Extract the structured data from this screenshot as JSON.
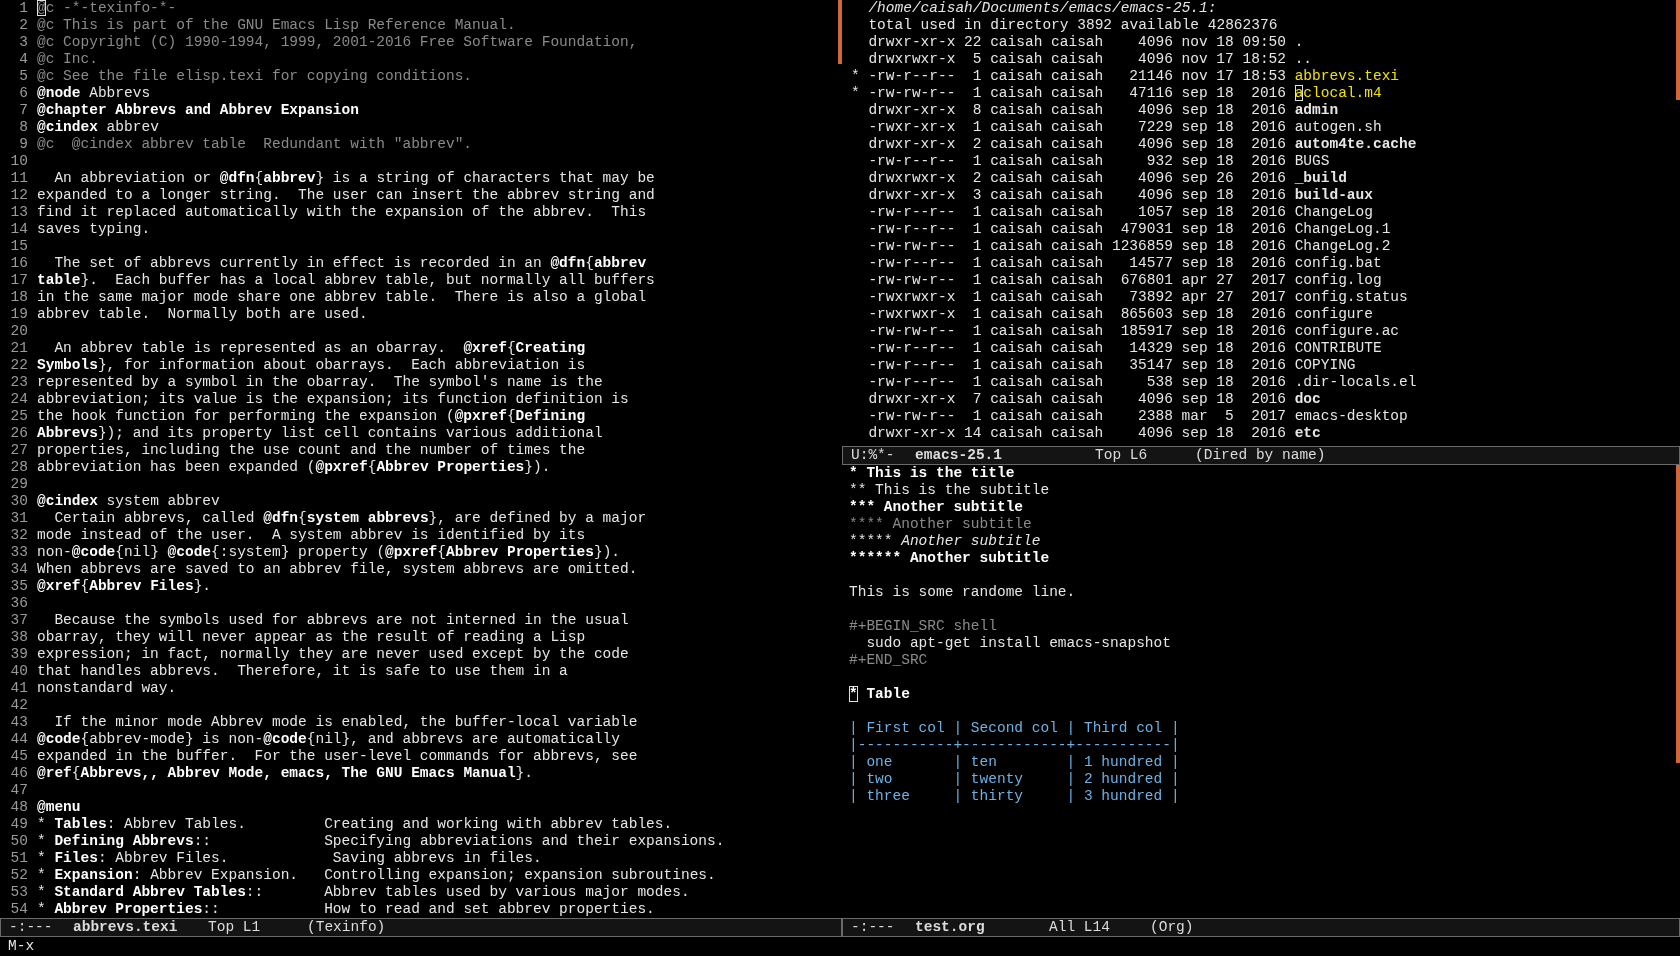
{
  "texinfo_buffer": {
    "lines": [
      {
        "n": "1",
        "kind": "comment",
        "cursor": true,
        "text": "@c -*-texinfo-*-"
      },
      {
        "n": "2",
        "kind": "comment",
        "text": "@c This is part of the GNU Emacs Lisp Reference Manual."
      },
      {
        "n": "3",
        "kind": "comment",
        "text": "@c Copyright (C) 1990-1994, 1999, 2001-2016 Free Software Foundation,"
      },
      {
        "n": "4",
        "kind": "comment",
        "text": "@c Inc."
      },
      {
        "n": "5",
        "kind": "comment",
        "text": "@c See the file elisp.texi for copying conditions."
      },
      {
        "n": "6",
        "kind": "text",
        "segs": [
          {
            "b": "@node"
          },
          " Abbrevs"
        ]
      },
      {
        "n": "7",
        "kind": "text",
        "segs": [
          {
            "b": "@chapter Abbrevs and Abbrev Expansion"
          }
        ]
      },
      {
        "n": "8",
        "kind": "text",
        "segs": [
          {
            "b": "@cindex"
          },
          " abbrev"
        ]
      },
      {
        "n": "9",
        "kind": "comment",
        "text": "@c  @cindex abbrev table  Redundant with \"abbrev\"."
      },
      {
        "n": "10",
        "kind": "blank"
      },
      {
        "n": "11",
        "kind": "text",
        "segs": [
          "  An abbreviation or ",
          {
            "b": "@dfn"
          },
          "{",
          {
            "b": "abbrev"
          },
          "} is a string of characters that may be"
        ]
      },
      {
        "n": "12",
        "kind": "text",
        "text": "expanded to a longer string.  The user can insert the abbrev string and"
      },
      {
        "n": "13",
        "kind": "text",
        "text": "find it replaced automatically with the expansion of the abbrev.  This"
      },
      {
        "n": "14",
        "kind": "text",
        "text": "saves typing."
      },
      {
        "n": "15",
        "kind": "blank"
      },
      {
        "n": "16",
        "kind": "text",
        "segs": [
          "  The set of abbrevs currently in effect is recorded in an ",
          {
            "b": "@dfn"
          },
          "{",
          {
            "b": "abbrev"
          }
        ]
      },
      {
        "n": "17",
        "kind": "text",
        "segs": [
          {
            "b": "table"
          },
          "}.  Each buffer has a local abbrev table, but normally all buffers"
        ]
      },
      {
        "n": "18",
        "kind": "text",
        "text": "in the same major mode share one abbrev table.  There is also a global"
      },
      {
        "n": "19",
        "kind": "text",
        "text": "abbrev table.  Normally both are used."
      },
      {
        "n": "20",
        "kind": "blank"
      },
      {
        "n": "21",
        "kind": "text",
        "segs": [
          "  An abbrev table is represented as an obarray.  ",
          {
            "b": "@xref"
          },
          "{",
          {
            "b": "Creating"
          }
        ]
      },
      {
        "n": "22",
        "kind": "text",
        "segs": [
          {
            "b": "Symbols"
          },
          "}, for information about obarrays.  Each abbreviation is"
        ]
      },
      {
        "n": "23",
        "kind": "text",
        "text": "represented by a symbol in the obarray.  The symbol's name is the"
      },
      {
        "n": "24",
        "kind": "text",
        "text": "abbreviation; its value is the expansion; its function definition is"
      },
      {
        "n": "25",
        "kind": "text",
        "segs": [
          "the hook function for performing the expansion (",
          {
            "b": "@pxref"
          },
          "{",
          {
            "b": "Defining"
          }
        ]
      },
      {
        "n": "26",
        "kind": "text",
        "segs": [
          {
            "b": "Abbrevs"
          },
          "}); and its property list cell contains various additional"
        ]
      },
      {
        "n": "27",
        "kind": "text",
        "text": "properties, including the use count and the number of times the"
      },
      {
        "n": "28",
        "kind": "text",
        "segs": [
          "abbreviation has been expanded (",
          {
            "b": "@pxref"
          },
          "{",
          {
            "b": "Abbrev Properties"
          },
          "})."
        ]
      },
      {
        "n": "29",
        "kind": "blank"
      },
      {
        "n": "30",
        "kind": "text",
        "segs": [
          {
            "b": "@cindex"
          },
          " system abbrev"
        ]
      },
      {
        "n": "31",
        "kind": "text",
        "segs": [
          "  Certain abbrevs, called ",
          {
            "b": "@dfn"
          },
          "{",
          {
            "b": "system abbrevs"
          },
          "}, are defined by a major"
        ]
      },
      {
        "n": "32",
        "kind": "text",
        "text": "mode instead of the user.  A system abbrev is identified by its"
      },
      {
        "n": "33",
        "kind": "text",
        "segs": [
          "non-",
          {
            "b": "@code"
          },
          "{nil} ",
          {
            "b": "@code"
          },
          "{:system} property (",
          {
            "b": "@pxref"
          },
          "{",
          {
            "b": "Abbrev Properties"
          },
          "})."
        ]
      },
      {
        "n": "34",
        "kind": "text",
        "text": "When abbrevs are saved to an abbrev file, system abbrevs are omitted."
      },
      {
        "n": "35",
        "kind": "text",
        "segs": [
          {
            "b": "@xref"
          },
          "{",
          {
            "b": "Abbrev Files"
          },
          "}."
        ]
      },
      {
        "n": "36",
        "kind": "blank"
      },
      {
        "n": "37",
        "kind": "text",
        "text": "  Because the symbols used for abbrevs are not interned in the usual"
      },
      {
        "n": "38",
        "kind": "text",
        "text": "obarray, they will never appear as the result of reading a Lisp"
      },
      {
        "n": "39",
        "kind": "text",
        "text": "expression; in fact, normally they are never used except by the code"
      },
      {
        "n": "40",
        "kind": "text",
        "text": "that handles abbrevs.  Therefore, it is safe to use them in a"
      },
      {
        "n": "41",
        "kind": "text",
        "text": "nonstandard way."
      },
      {
        "n": "42",
        "kind": "blank"
      },
      {
        "n": "43",
        "kind": "text",
        "text": "  If the minor mode Abbrev mode is enabled, the buffer-local variable"
      },
      {
        "n": "44",
        "kind": "text",
        "segs": [
          {
            "b": "@code"
          },
          "{abbrev-mode} is non-",
          {
            "b": "@code"
          },
          "{nil}, and abbrevs are automatically"
        ]
      },
      {
        "n": "45",
        "kind": "text",
        "text": "expanded in the buffer.  For the user-level commands for abbrevs, see"
      },
      {
        "n": "46",
        "kind": "text",
        "segs": [
          {
            "b": "@ref"
          },
          "{",
          {
            "b": "Abbrevs,, Abbrev Mode, emacs, The GNU Emacs Manual"
          },
          "}."
        ]
      },
      {
        "n": "47",
        "kind": "blank"
      },
      {
        "n": "48",
        "kind": "text",
        "segs": [
          {
            "b": "@menu"
          }
        ]
      },
      {
        "n": "49",
        "kind": "text",
        "segs": [
          "* ",
          {
            "b": "Tables"
          },
          ": Abbrev Tables.         Creating and working with abbrev tables."
        ]
      },
      {
        "n": "50",
        "kind": "text",
        "segs": [
          "* ",
          {
            "b": "Defining Abbrevs"
          },
          "::             Specifying abbreviations and their expansions."
        ]
      },
      {
        "n": "51",
        "kind": "text",
        "segs": [
          "* ",
          {
            "b": "Files"
          },
          ": Abbrev Files.            Saving abbrevs in files."
        ]
      },
      {
        "n": "52",
        "kind": "text",
        "segs": [
          "* ",
          {
            "b": "Expansion"
          },
          ": Abbrev Expansion.   Controlling expansion; expansion subroutines."
        ]
      },
      {
        "n": "53",
        "kind": "text",
        "segs": [
          "* ",
          {
            "b": "Standard Abbrev Tables"
          },
          "::       Abbrev tables used by various major modes."
        ]
      },
      {
        "n": "54",
        "kind": "text",
        "segs": [
          "* ",
          {
            "b": "Abbrev Properties"
          },
          "::            How to read and set abbrev properties."
        ]
      }
    ],
    "mode_line": {
      "status": "-:---",
      "buffer": "abbrevs.texi",
      "position": "Top L1",
      "mode": "(Texinfo)"
    }
  },
  "dired_buffer": {
    "path": "/home/caisah/Documents/emacs/emacs-25.1:",
    "total": "total used in directory 3892 available 42862376",
    "rows": [
      {
        "marked": false,
        "kind": "plain",
        "perms": "drwxr-xr-x",
        "links": "22",
        "owner": "caisah",
        "group": "caisah",
        "size": "4096",
        "date": "nov 18 09:50",
        "name": "."
      },
      {
        "marked": false,
        "kind": "plain",
        "perms": "drwxrwxr-x",
        "links": "5",
        "owner": "caisah",
        "group": "caisah",
        "size": "4096",
        "date": "nov 17 18:52",
        "name": ".."
      },
      {
        "marked": true,
        "mark": "*",
        "kind": "file",
        "perms": "-rw-r--r--",
        "links": "1",
        "owner": "caisah",
        "group": "caisah",
        "size": "21146",
        "date": "nov 17 18:53",
        "name": "abbrevs.texi"
      },
      {
        "marked": true,
        "mark": "*",
        "cursor": true,
        "kind": "file",
        "perms": "-rw-rw-r--",
        "links": "1",
        "owner": "caisah",
        "group": "caisah",
        "size": "47116",
        "date": "sep 18  2016",
        "name": "aclocal.m4"
      },
      {
        "marked": false,
        "kind": "directory",
        "perms": "drwxr-xr-x",
        "links": "8",
        "owner": "caisah",
        "group": "caisah",
        "size": "4096",
        "date": "sep 18  2016",
        "name": "admin"
      },
      {
        "marked": false,
        "kind": "file",
        "perms": "-rwxr-xr-x",
        "links": "1",
        "owner": "caisah",
        "group": "caisah",
        "size": "7229",
        "date": "sep 18  2016",
        "name": "autogen.sh"
      },
      {
        "marked": false,
        "kind": "directory",
        "perms": "drwxr-xr-x",
        "links": "2",
        "owner": "caisah",
        "group": "caisah",
        "size": "4096",
        "date": "sep 18  2016",
        "name": "autom4te.cache"
      },
      {
        "marked": false,
        "kind": "file",
        "perms": "-rw-r--r--",
        "links": "1",
        "owner": "caisah",
        "group": "caisah",
        "size": "932",
        "date": "sep 18  2016",
        "name": "BUGS"
      },
      {
        "marked": false,
        "kind": "directory",
        "perms": "drwxrwxr-x",
        "links": "2",
        "owner": "caisah",
        "group": "caisah",
        "size": "4096",
        "date": "sep 26  2016",
        "name": "_build"
      },
      {
        "marked": false,
        "kind": "directory",
        "perms": "drwxr-xr-x",
        "links": "3",
        "owner": "caisah",
        "group": "caisah",
        "size": "4096",
        "date": "sep 18  2016",
        "name": "build-aux"
      },
      {
        "marked": false,
        "kind": "file",
        "perms": "-rw-r--r--",
        "links": "1",
        "owner": "caisah",
        "group": "caisah",
        "size": "1057",
        "date": "sep 18  2016",
        "name": "ChangeLog"
      },
      {
        "marked": false,
        "kind": "file",
        "perms": "-rw-r--r--",
        "links": "1",
        "owner": "caisah",
        "group": "caisah",
        "size": "479031",
        "date": "sep 18  2016",
        "name": "ChangeLog.1"
      },
      {
        "marked": false,
        "kind": "file",
        "perms": "-rw-rw-r--",
        "links": "1",
        "owner": "caisah",
        "group": "caisah",
        "size": "1236859",
        "date": "sep 18  2016",
        "name": "ChangeLog.2"
      },
      {
        "marked": false,
        "kind": "file",
        "perms": "-rw-r--r--",
        "links": "1",
        "owner": "caisah",
        "group": "caisah",
        "size": "14577",
        "date": "sep 18  2016",
        "name": "config.bat"
      },
      {
        "marked": false,
        "kind": "file",
        "perms": "-rw-rw-r--",
        "links": "1",
        "owner": "caisah",
        "group": "caisah",
        "size": "676801",
        "date": "apr 27  2017",
        "name": "config.log"
      },
      {
        "marked": false,
        "kind": "file",
        "perms": "-rwxrwxr-x",
        "links": "1",
        "owner": "caisah",
        "group": "caisah",
        "size": "73892",
        "date": "apr 27  2017",
        "name": "config.status"
      },
      {
        "marked": false,
        "kind": "file",
        "perms": "-rwxrwxr-x",
        "links": "1",
        "owner": "caisah",
        "group": "caisah",
        "size": "865603",
        "date": "sep 18  2016",
        "name": "configure"
      },
      {
        "marked": false,
        "kind": "file",
        "perms": "-rw-rw-r--",
        "links": "1",
        "owner": "caisah",
        "group": "caisah",
        "size": "185917",
        "date": "sep 18  2016",
        "name": "configure.ac"
      },
      {
        "marked": false,
        "kind": "file",
        "perms": "-rw-r--r--",
        "links": "1",
        "owner": "caisah",
        "group": "caisah",
        "size": "14329",
        "date": "sep 18  2016",
        "name": "CONTRIBUTE"
      },
      {
        "marked": false,
        "kind": "file",
        "perms": "-rw-r--r--",
        "links": "1",
        "owner": "caisah",
        "group": "caisah",
        "size": "35147",
        "date": "sep 18  2016",
        "name": "COPYING"
      },
      {
        "marked": false,
        "kind": "file",
        "perms": "-rw-r--r--",
        "links": "1",
        "owner": "caisah",
        "group": "caisah",
        "size": "538",
        "date": "sep 18  2016",
        "name": ".dir-locals.el"
      },
      {
        "marked": false,
        "kind": "directory",
        "perms": "drwxr-xr-x",
        "links": "7",
        "owner": "caisah",
        "group": "caisah",
        "size": "4096",
        "date": "sep 18  2016",
        "name": "doc"
      },
      {
        "marked": false,
        "kind": "file",
        "perms": "-rw-rw-r--",
        "links": "1",
        "owner": "caisah",
        "group": "caisah",
        "size": "2388",
        "date": "mar  5  2017",
        "name": "emacs-desktop"
      },
      {
        "marked": false,
        "kind": "directory",
        "perms": "drwxr-xr-x",
        "links": "14",
        "owner": "caisah",
        "group": "caisah",
        "size": "4096",
        "date": "sep 18  2016",
        "name": "etc"
      }
    ],
    "mode_line": {
      "status": "U:%*-",
      "buffer": "emacs-25.1",
      "position": "Top L6",
      "mode": "(Dired by name)"
    }
  },
  "org_buffer": {
    "lines": [
      {
        "kind": "text",
        "segs": [
          {
            "b": "* This is the title"
          }
        ]
      },
      {
        "kind": "text",
        "text": "** This is the subtitle"
      },
      {
        "kind": "text",
        "segs": [
          {
            "b": "*** Another subtitle"
          }
        ]
      },
      {
        "kind": "comment",
        "text": "**** Another subtitle"
      },
      {
        "kind": "text",
        "segs": [
          "***** ",
          {
            "i": "Another subtitle"
          }
        ]
      },
      {
        "kind": "text",
        "segs": [
          {
            "b": "****** Another subtitle"
          }
        ]
      },
      {
        "kind": "blank"
      },
      {
        "kind": "text",
        "text": "This is some randome line."
      },
      {
        "kind": "blank"
      },
      {
        "kind": "comment",
        "text": "#+BEGIN_SRC shell"
      },
      {
        "kind": "text",
        "text": "  sudo apt-get install emacs-snapshot"
      },
      {
        "kind": "comment",
        "text": "#+END_SRC"
      },
      {
        "kind": "blank"
      },
      {
        "kind": "text",
        "cursor": true,
        "segs": [
          {
            "b": "* Table"
          }
        ]
      },
      {
        "kind": "blank"
      },
      {
        "kind": "table",
        "text": "| First col | Second col | Third col |"
      },
      {
        "kind": "table",
        "text": "|-----------+------------+-----------|"
      },
      {
        "kind": "table",
        "text": "| one       | ten        | 1 hundred |"
      },
      {
        "kind": "table",
        "text": "| two       | twenty     | 2 hundred |"
      },
      {
        "kind": "table",
        "text": "| three     | thirty     | 3 hundred |"
      }
    ],
    "mode_line": {
      "status": "-:---",
      "buffer": "test.org",
      "position": "All L14",
      "mode": "(Org)"
    }
  },
  "minibuffer": {
    "prompt": "M-x"
  }
}
